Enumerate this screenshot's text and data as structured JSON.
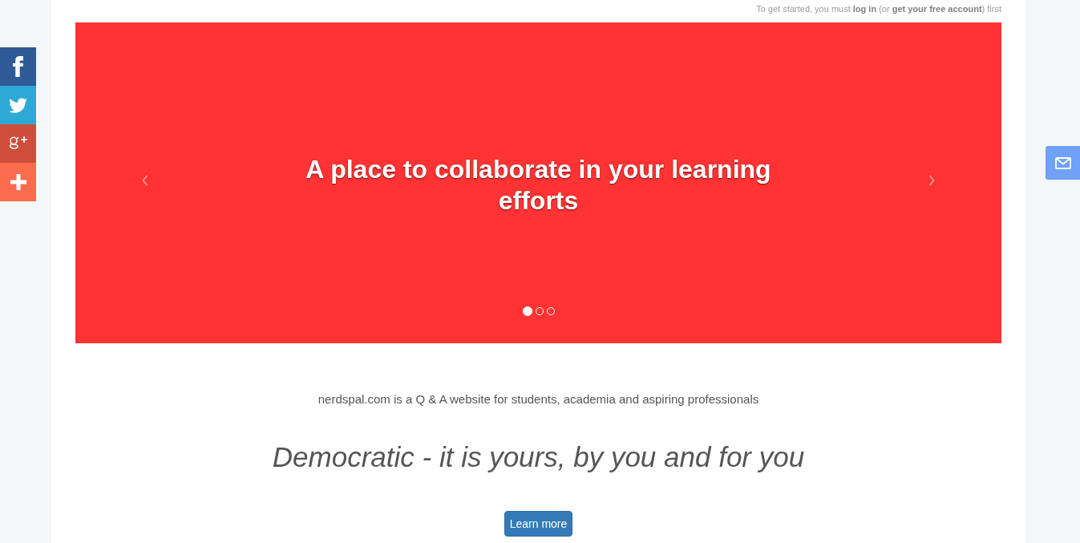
{
  "notice": [
    {
      "kind": "text",
      "text": "To get started, you must "
    },
    {
      "kind": "link",
      "text": "log in"
    },
    {
      "kind": "text",
      "text": " (or "
    },
    {
      "kind": "link",
      "text": "get your free account"
    },
    {
      "kind": "text",
      "text": ") first"
    }
  ],
  "social_bar": [
    {
      "kind": "facebook",
      "color": "#2e5a96"
    },
    {
      "kind": "twitter",
      "color": "#2ea9d6"
    },
    {
      "kind": "googleplus",
      "color": "#cf4e3b"
    },
    {
      "kind": "more",
      "color": "#fb6c4e"
    }
  ],
  "carousel": {
    "caption": "A place to collaborate in your learning efforts",
    "indicators": [
      {
        "selected": true
      },
      {
        "selected": false
      },
      {
        "selected": false
      }
    ]
  },
  "intro": {
    "tagline": "nerdspal.com is a Q & A website for students, academia and aspiring professionals",
    "motto": "Democratic - it is yours, by you and for you",
    "button": "Learn more"
  }
}
